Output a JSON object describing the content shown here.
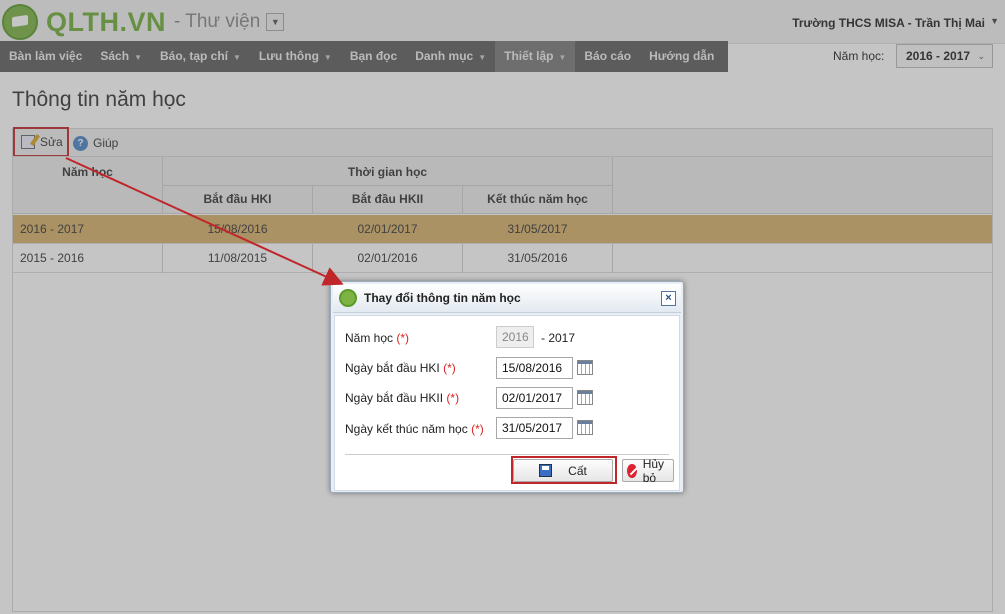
{
  "header": {
    "logo_text": "QLTH.VN",
    "logo_subtitle": "- Thư viện",
    "user_label": "Trường THCS MISA - Trần Thị Mai"
  },
  "nav": {
    "items": [
      {
        "label": "Bàn làm việc"
      },
      {
        "label": "Sách"
      },
      {
        "label": "Báo, tạp chí"
      },
      {
        "label": "Lưu thông"
      },
      {
        "label": "Bạn đọc"
      },
      {
        "label": "Danh mục"
      },
      {
        "label": "Thiết lập"
      },
      {
        "label": "Báo cáo"
      },
      {
        "label": "Hướng dẫn"
      }
    ],
    "year_label": "Năm học:",
    "year_value": "2016 - 2017"
  },
  "page": {
    "title": "Thông tin năm học"
  },
  "toolbar": {
    "edit_label": "Sửa",
    "help_label": "Giúp"
  },
  "grid": {
    "col_year": "Năm học",
    "col_group": "Thời gian học",
    "col_hk1": "Bắt đầu HKI",
    "col_hk2": "Bắt đầu HKII",
    "col_end": "Kết thúc năm học",
    "rows": [
      {
        "year": "2016 - 2017",
        "hk1": "15/08/2016",
        "hk2": "02/01/2017",
        "end": "31/05/2017"
      },
      {
        "year": "2015 - 2016",
        "hk1": "11/08/2015",
        "hk2": "02/01/2016",
        "end": "31/05/2016"
      }
    ]
  },
  "dialog": {
    "title": "Thay đổi thông tin năm học",
    "year_label": "Năm học",
    "year_start": "2016",
    "year_end": "- 2017",
    "hk1_label": "Ngày bắt đầu HKI",
    "hk1_value": "15/08/2016",
    "hk2_label": "Ngày bắt đầu HKII",
    "hk2_value": "02/01/2017",
    "end_label": "Ngày kết thúc năm học",
    "end_value": "31/05/2017",
    "required_mark": "(*)",
    "save_label": "Cất",
    "cancel_label": "Hủy bỏ"
  },
  "colors": {
    "brand_green": "#6fae3a",
    "nav_bg": "#5f5f5f",
    "selected_row": "#d8b16a",
    "highlight_red": "#c0262a"
  }
}
